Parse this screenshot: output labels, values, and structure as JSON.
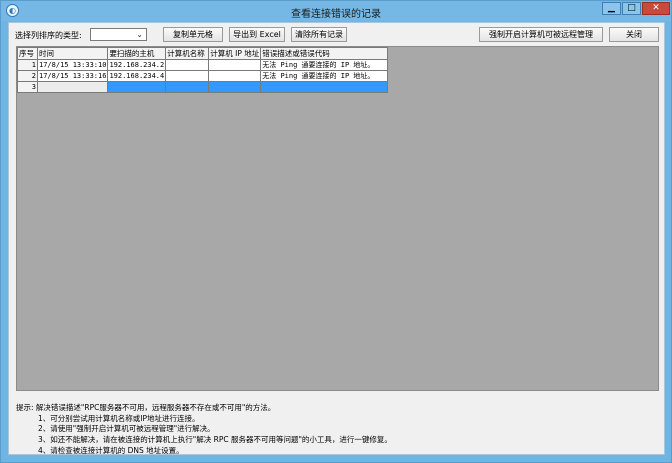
{
  "window": {
    "title": "查看连接错误的记录",
    "icon": "app-logo-icon"
  },
  "controls": {
    "sort_label": "选择列排序的类型:",
    "sort_value": "",
    "copy_cells": "复制单元格",
    "export_excel": "导出到 Excel",
    "clear_all": "清除所有记录",
    "force_remote": "强制开启计算机可被远程管理",
    "close": "关闭"
  },
  "table": {
    "columns": [
      "序号",
      "时间",
      "要扫描的主机",
      "计算机名称",
      "计算机 IP 地址",
      "错误描述或错误代码"
    ],
    "rows": [
      [
        "1",
        "17/8/15 13:33:10",
        "192.168.234.2",
        "",
        "",
        "无法 Ping 通要连接的 IP 地址。"
      ],
      [
        "2",
        "17/8/15 13:33:16",
        "192.168.234.4",
        "",
        "",
        "无法 Ping 通要连接的 IP 地址。"
      ],
      [
        "3",
        "",
        "",
        "",
        "",
        ""
      ]
    ]
  },
  "tips": {
    "header": "提示: 解决错误描述\"RPC服务器不可用，远程服务器不存在或不可用\"的方法。",
    "items": [
      "1、可分别尝试用计算机名称或IP地址进行连接。",
      "2、请使用\"强制开启计算机可被远程管理\"进行解决。",
      "3、如还不能解决，请在被连接的计算机上执行\"解决 RPC 服务器不可用等问题\"的小工具，进行一键修复。",
      "4、请检查被连接计算机的 DNS 地址设置。"
    ]
  }
}
